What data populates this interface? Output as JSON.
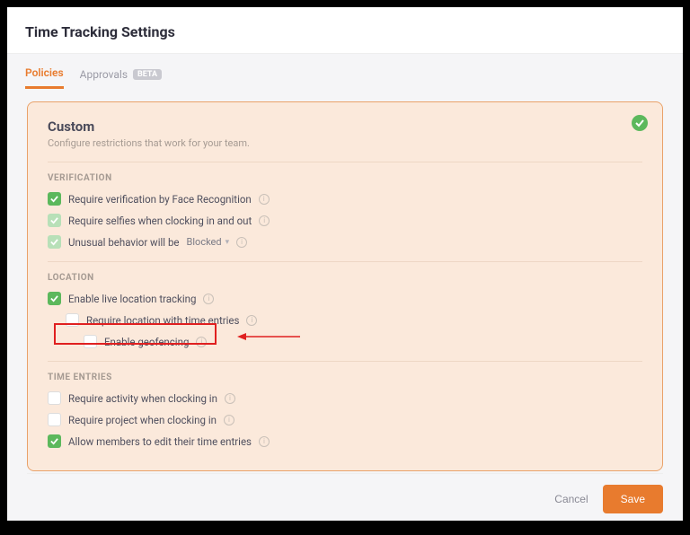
{
  "header": {
    "title": "Time Tracking Settings"
  },
  "tabs": {
    "policies": "Policies",
    "approvals": "Approvals",
    "beta_badge": "BETA"
  },
  "panel": {
    "title": "Custom",
    "subtitle": "Configure restrictions that work for your team."
  },
  "sections": {
    "verification": {
      "heading": "VERIFICATION",
      "face": "Require verification by Face Recognition",
      "selfies": "Require selfies when clocking in and out",
      "unusual_prefix": "Unusual behavior will be",
      "unusual_value": "Blocked"
    },
    "location": {
      "heading": "LOCATION",
      "live": "Enable live location tracking",
      "req_loc": "Require location with time entries",
      "geofence": "Enable geofencing"
    },
    "time_entries": {
      "heading": "TIME ENTRIES",
      "activity": "Require activity when clocking in",
      "project": "Require project when clocking in",
      "edit": "Allow members to edit their time entries"
    }
  },
  "footer": {
    "cancel": "Cancel",
    "save": "Save"
  },
  "colors": {
    "accent": "#e87b2e",
    "success": "#5cb85c",
    "annotation": "#e02020"
  }
}
